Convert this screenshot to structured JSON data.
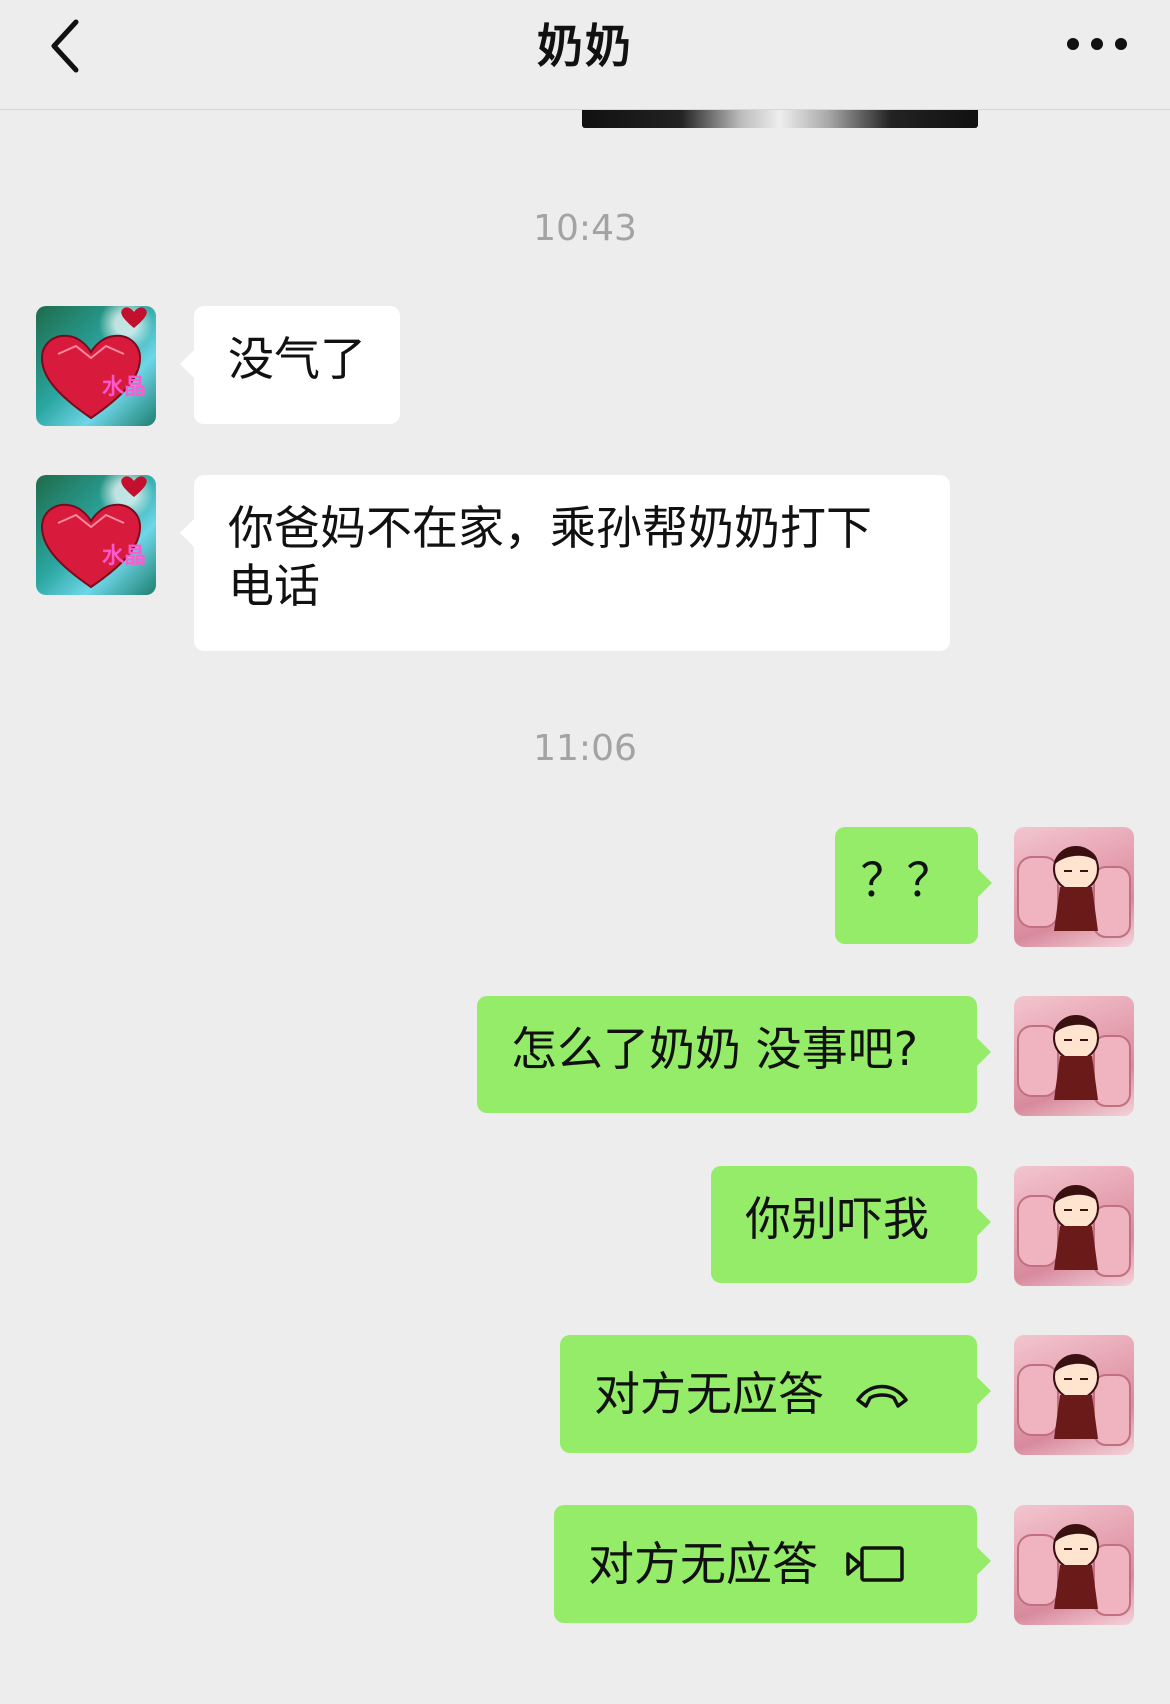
{
  "header": {
    "title": "奶奶",
    "back_icon": "chevron-left-icon",
    "more_icon": "more-dots-icon"
  },
  "timestamps": [
    "10:43",
    "11:06"
  ],
  "messages": [
    {
      "sender": "grandma",
      "text": "没气了"
    },
    {
      "sender": "grandma",
      "text": "你爸妈不在家，乘孙帮奶奶打下电话"
    },
    {
      "sender": "me",
      "text": "？？"
    },
    {
      "sender": "me",
      "text": "怎么了奶奶 没事吧?"
    },
    {
      "sender": "me",
      "text": "你别吓我"
    },
    {
      "sender": "me",
      "text": "对方无应答",
      "icon": "phone-hangup-icon"
    },
    {
      "sender": "me",
      "text": "对方无应答",
      "icon": "video-call-icon"
    }
  ],
  "avatars": {
    "grandma": {
      "label": "水晶",
      "colors": [
        "#1f6b4a",
        "#2aa6a0",
        "#d81b3c"
      ]
    },
    "me": {
      "colors": [
        "#f3c6cf",
        "#e6a3b2",
        "#5a1a1a"
      ]
    }
  },
  "colors": {
    "background": "#ededed",
    "bubble_incoming": "#ffffff",
    "bubble_outgoing": "#95ec69",
    "timestamp": "#a3a3a3"
  }
}
